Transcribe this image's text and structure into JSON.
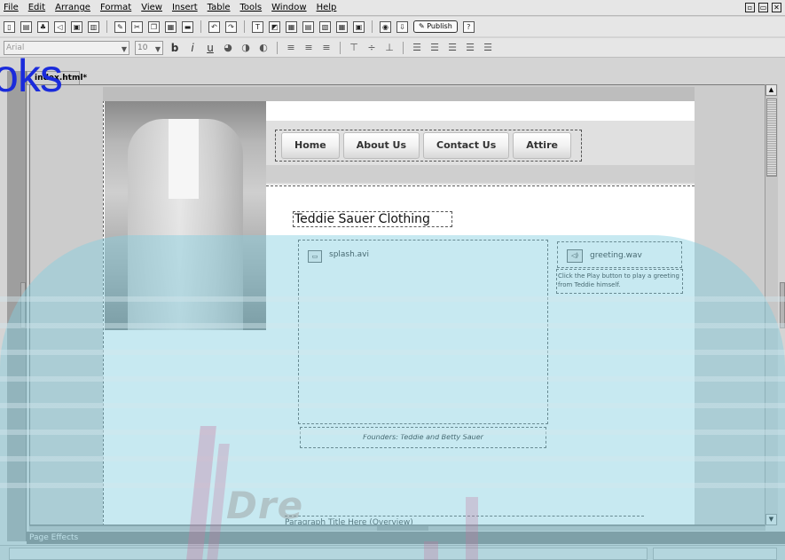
{
  "menubar": {
    "items": [
      "File",
      "Edit",
      "Arrange",
      "Format",
      "View",
      "Insert",
      "Table",
      "Tools",
      "Window",
      "Help"
    ]
  },
  "toolbar": {
    "publish_label": "Publish",
    "font_name": "Arial",
    "font_size": "10",
    "bold": "b",
    "italic": "i",
    "underline": "u"
  },
  "document": {
    "tab_title": "index.html*"
  },
  "watermark": {
    "text": "oks",
    "faint_text": "Dre"
  },
  "site": {
    "nav": [
      "Home",
      "About Us",
      "Contact Us",
      "Attire"
    ],
    "title": "Teddie Sauer Clothing",
    "video_file": "splash.avi",
    "caption": "Founders: Teddie and Betty Sauer",
    "audio_file": "greeting.wav",
    "audio_description": "Click the Play button to play a greeting from Teddie himself.",
    "paragraph_title": "Paragraph Title Here (Overview)"
  },
  "panel": {
    "page_effects_label": "Page Effects"
  }
}
